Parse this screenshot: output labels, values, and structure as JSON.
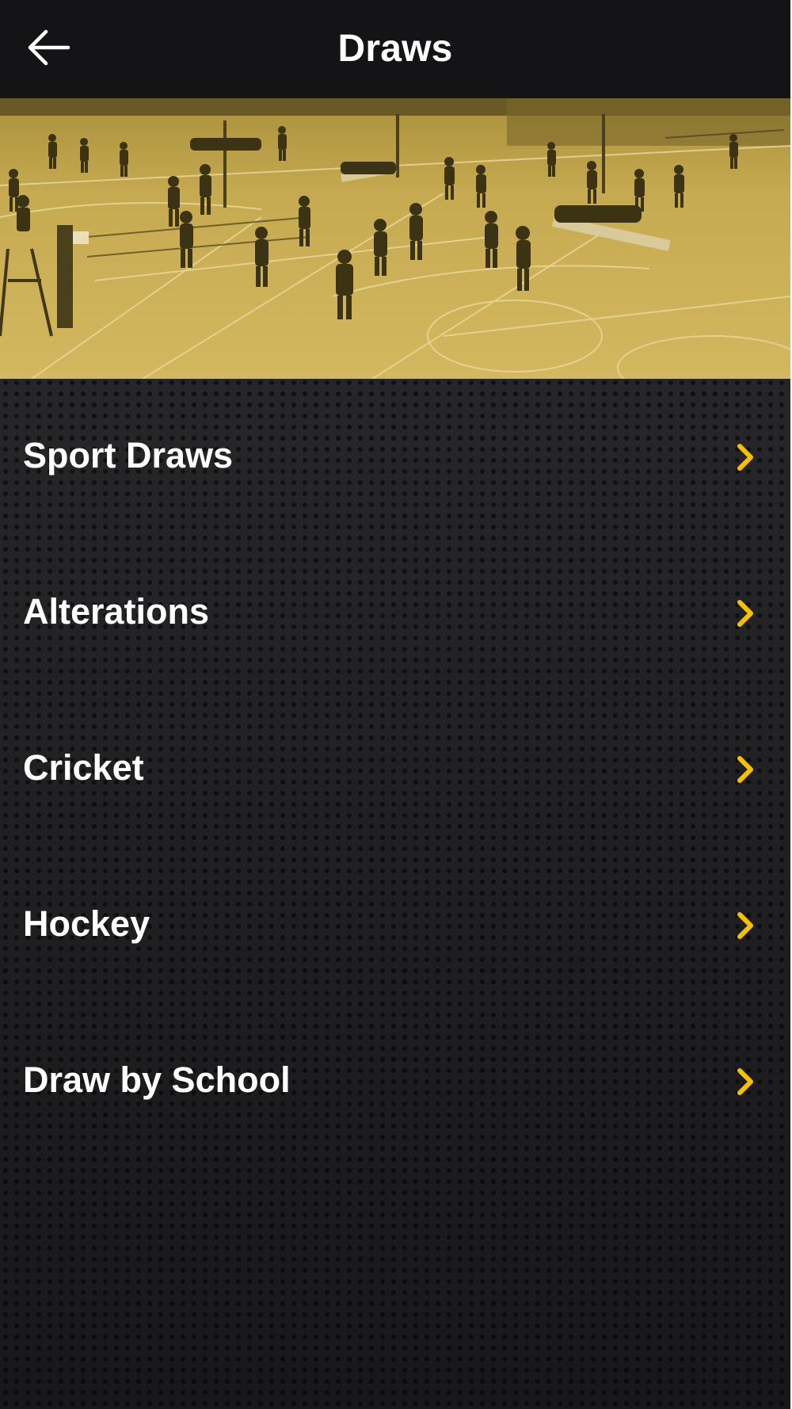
{
  "header": {
    "title": "Draws",
    "back_icon": "arrow-left-icon"
  },
  "hero": {
    "image": "volleyball-hall-photo"
  },
  "menu": {
    "chevron_icon": "chevron-right-icon",
    "chevron_color": "#f5c000",
    "items": [
      {
        "label": "Sport Draws"
      },
      {
        "label": "Alterations"
      },
      {
        "label": "Cricket"
      },
      {
        "label": "Hockey"
      },
      {
        "label": "Draw by School"
      }
    ]
  },
  "colors": {
    "header_bg": "#141417",
    "body_bg": "#222224",
    "hero_tint": "#c8ab4e",
    "text": "#ffffff"
  }
}
